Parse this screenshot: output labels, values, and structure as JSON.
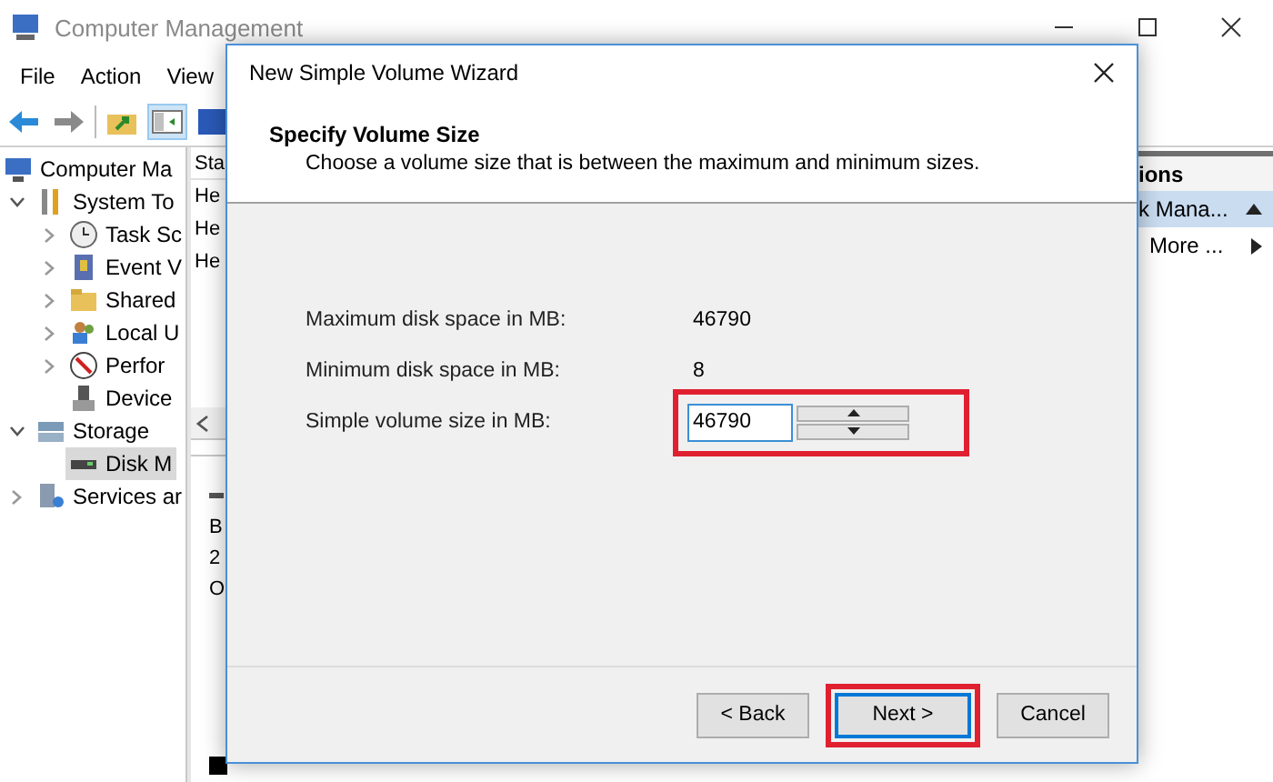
{
  "window": {
    "title": "Computer Management"
  },
  "menu": [
    "File",
    "Action",
    "View"
  ],
  "tree": [
    {
      "label": "Computer Ma",
      "selected": false,
      "children": [
        {
          "label": "System To",
          "selected": false,
          "expanded": true,
          "children": [
            {
              "label": "Task Sc",
              "selected": false,
              "expanded": false
            },
            {
              "label": "Event V",
              "selected": false,
              "expanded": false
            },
            {
              "label": "Shared",
              "selected": false,
              "expanded": false
            },
            {
              "label": "Local U",
              "selected": false,
              "expanded": false
            },
            {
              "label": "Perfor",
              "selected": false,
              "expanded": false
            },
            {
              "label": "Device",
              "selected": false
            }
          ]
        },
        {
          "label": "Storage",
          "selected": false,
          "expanded": true,
          "children": [
            {
              "label": "Disk M",
              "selected": true
            }
          ]
        },
        {
          "label": "Services ar",
          "selected": false,
          "expanded": false
        }
      ]
    }
  ],
  "volume_list": {
    "columns": [
      "Sta"
    ],
    "rows": [
      "He",
      "He",
      "He"
    ]
  },
  "disk_panel": {
    "lines": [
      "B",
      "2",
      "O"
    ]
  },
  "actions": {
    "title": "ions",
    "items": [
      {
        "label": "k Mana...",
        "kind": "section"
      },
      {
        "label": "More ...",
        "kind": "link"
      }
    ]
  },
  "dialog": {
    "title": "New Simple Volume Wizard",
    "heading": "Specify Volume Size",
    "subtitle": "Choose a volume size that is between the maximum and minimum sizes.",
    "fields": [
      {
        "label": "Maximum disk space in MB:",
        "kind": "text",
        "value": "46790",
        "highlighted": false
      },
      {
        "label": "Minimum disk space in MB:",
        "kind": "text",
        "value": "8",
        "highlighted": false
      },
      {
        "label": "Simple volume size in MB:",
        "kind": "spinner",
        "value": "46790",
        "highlighted": true
      }
    ],
    "buttons": [
      {
        "label": "< Back",
        "default": false,
        "highlighted": false
      },
      {
        "label": "Next >",
        "default": true,
        "highlighted": true
      },
      {
        "label": "Cancel",
        "default": false,
        "highlighted": false
      }
    ]
  }
}
